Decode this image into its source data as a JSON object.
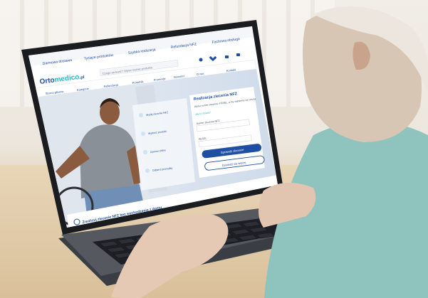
{
  "header": {
    "topbar_items": [
      "Darmowa dostawa",
      "Tysiące produktów",
      "Szybka realizacja",
      "Refundacja NFZ",
      "Fachowa obsługa"
    ],
    "logo_text_prefix": "Orto",
    "logo_text_suffix": "medico",
    "logo_tld": ".pl",
    "search_placeholder": "Czego szukasz? Wpisz nazwę produktu",
    "icons": [
      "user-icon",
      "heart-icon",
      "cart-icon",
      "menu-icon"
    ],
    "nav_items": [
      "Strona główna",
      "Kategorie",
      "Refundacja",
      "Poradnik",
      "Promocje",
      "Nowości",
      "O nas",
      "Kontakt"
    ]
  },
  "hero": {
    "steps": [
      "Wyślij zlecenie NFZ",
      "Wybierz produkt",
      "Zamów online",
      "Odbierz przesyłkę"
    ],
    "card_title": "Realizacja zlecenia NFZ",
    "card_text": "Wpisz numer zlecenia i PESEL, a my zajmiemy się resztą",
    "card_link": "Jak to działa?",
    "field_label_1": "Numer zlecenia NFZ",
    "field_label_2": "PESEL",
    "primary_button": "Sprawdź zlecenie",
    "secondary_button": "Dowiedz się więcej"
  },
  "footer_bar": {
    "text": "Zrealizuj zlecenie NFZ bez wychodzenia z domu"
  },
  "colors": {
    "brand_blue": "#1f4fa3",
    "accent_teal": "#2ab7c9",
    "primary_button": "#1f4fa3"
  }
}
